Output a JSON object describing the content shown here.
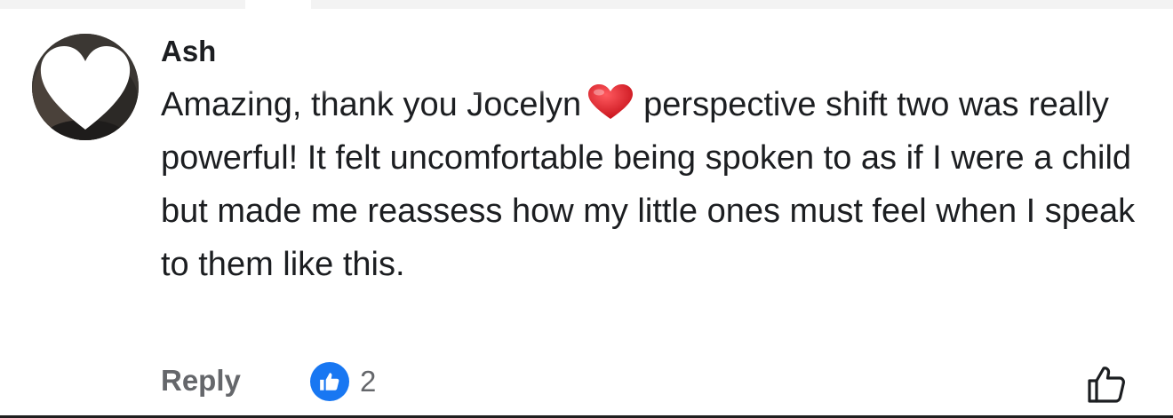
{
  "comment": {
    "author": "Ash",
    "text_before_emoji": "Amazing, thank you Jocelyn",
    "emoji": "red-heart-emoji",
    "text_after_emoji": "perspective shift two was really powerful! It felt uncomfortable being spoken to as if I were a child but made me reassess how my little ones must feel when I speak to them like this."
  },
  "actions": {
    "reply_label": "Reply",
    "reaction_count": "2",
    "reaction_icon": "like-icon",
    "like_button_icon": "thumbs-up-outline-icon"
  },
  "colors": {
    "text": "#1c1e21",
    "secondary_text": "#65676b",
    "like_blue": "#1877f2",
    "heart_red": "#e0232f"
  }
}
